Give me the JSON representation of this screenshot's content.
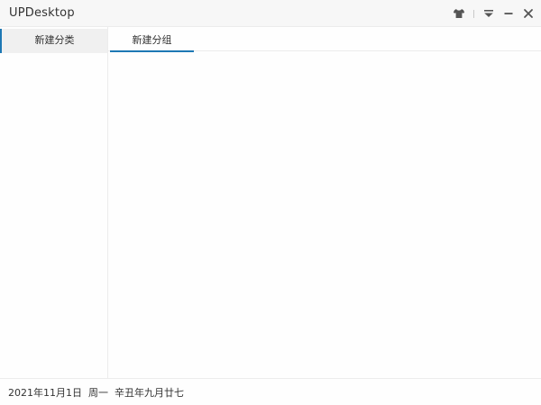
{
  "window": {
    "title": "UPDesktop",
    "controls": {
      "skin_icon": "tshirt-icon",
      "menu_icon": "dropdown-menu-icon",
      "minimize_icon": "minimize-icon",
      "close_icon": "close-icon"
    }
  },
  "sidebar": {
    "items": [
      {
        "label": "新建分类",
        "active": true
      }
    ]
  },
  "main": {
    "tabs": [
      {
        "label": "新建分组",
        "active": true
      }
    ]
  },
  "statusbar": {
    "date": "2021年11月1日",
    "weekday": "周一",
    "lunar": "辛丑年九月廿七"
  },
  "colors": {
    "accent": "#1d78b4",
    "titlebar_bg": "#f7f7f7",
    "selected_item_bg": "#f0f0f0",
    "border": "#ececec"
  }
}
